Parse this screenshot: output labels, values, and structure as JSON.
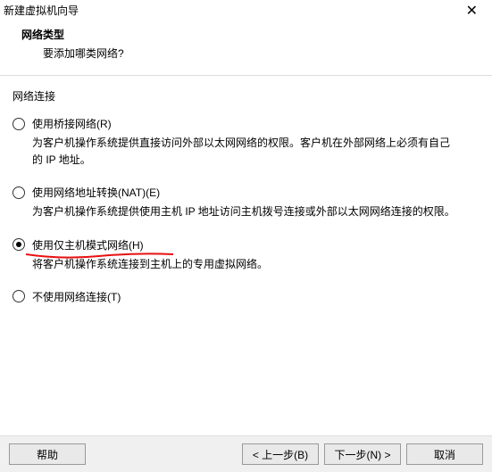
{
  "window": {
    "title": "新建虚拟机向导",
    "close": "✕"
  },
  "header": {
    "title": "网络类型",
    "subtitle": "要添加哪类网络?"
  },
  "group": {
    "label": "网络连接"
  },
  "options": [
    {
      "label": "使用桥接网络(R)",
      "desc": "为客户机操作系统提供直接访问外部以太网网络的权限。客户机在外部网络上必须有自己的 IP 地址。",
      "selected": false
    },
    {
      "label": "使用网络地址转换(NAT)(E)",
      "desc": "为客户机操作系统提供使用主机 IP 地址访问主机拨号连接或外部以太网网络连接的权限。",
      "selected": false
    },
    {
      "label": "使用仅主机模式网络(H)",
      "desc": "将客户机操作系统连接到主机上的专用虚拟网络。",
      "selected": true
    },
    {
      "label": "不使用网络连接(T)",
      "desc": "",
      "selected": false
    }
  ],
  "footer": {
    "help": "帮助",
    "back": "< 上一步(B)",
    "next": "下一步(N) >",
    "cancel": "取消"
  }
}
